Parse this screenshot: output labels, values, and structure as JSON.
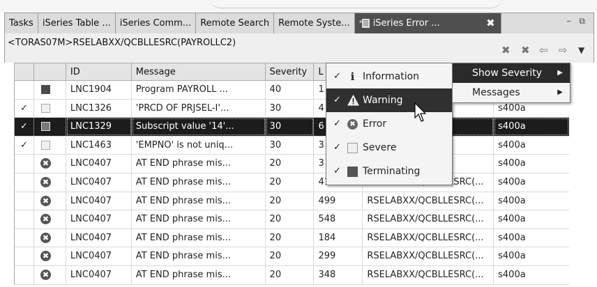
{
  "tabs": [
    {
      "label": "Tasks"
    },
    {
      "label": "iSeries Table ..."
    },
    {
      "label": "iSeries Comm..."
    },
    {
      "label": "Remote Search"
    },
    {
      "label": "Remote Syste..."
    },
    {
      "label": "iSeries Error ..."
    }
  ],
  "path": "<TORAS07M>RSELABXX/QCBLLESRC(PAYROLLC2)",
  "columns": {
    "id": "ID",
    "message": "Message",
    "severity": "Severity",
    "line": "L"
  },
  "rows": [
    {
      "check": "",
      "icon": "terminating",
      "id": "LNC1904",
      "message": "Program PAYROLL ...",
      "severity": "40",
      "line": "1",
      "file": "",
      "system": ""
    },
    {
      "check": "✓",
      "icon": "severe",
      "id": "LNC1326",
      "message": "'PRCD OF PRJSEL-I'...",
      "severity": "30",
      "line": "4",
      "file": "TSRC(...",
      "system": "s400a"
    },
    {
      "check": "✓",
      "icon": "terminating",
      "id": "LNC1329",
      "message": "Subscript value '14'...",
      "severity": "30",
      "line": "6",
      "file": "ESRC(...",
      "system": "s400a"
    },
    {
      "check": "✓",
      "icon": "severe",
      "id": "LNC1463",
      "message": "'EMPNO' is not uniq...",
      "severity": "30",
      "line": "3",
      "file": "TSRC(...",
      "system": "s400a"
    },
    {
      "check": "",
      "icon": "error",
      "id": "LNC0407",
      "message": "AT END phrase mis...",
      "severity": "20",
      "line": "3",
      "file": "TSRC(...",
      "system": "s400a"
    },
    {
      "check": "",
      "icon": "error",
      "id": "LNC0407",
      "message": "AT END phrase mis...",
      "severity": "20",
      "line": "410",
      "file": "RSELABXX/QCBLLESRC(...",
      "system": "s400a"
    },
    {
      "check": "",
      "icon": "error",
      "id": "LNC0407",
      "message": "AT END phrase mis...",
      "severity": "20",
      "line": "499",
      "file": "RSELABXX/QCBLLESRC(...",
      "system": "s400a"
    },
    {
      "check": "",
      "icon": "error",
      "id": "LNC0407",
      "message": "AT END phrase mis...",
      "severity": "20",
      "line": "548",
      "file": "RSELABXX/QCBLLESRC(...",
      "system": "s400a"
    },
    {
      "check": "",
      "icon": "error",
      "id": "LNC0407",
      "message": "AT END phrase mis...",
      "severity": "20",
      "line": "184",
      "file": "RSELABXX/QCBLLESRC(...",
      "system": "s400a"
    },
    {
      "check": "",
      "icon": "error",
      "id": "LNC0407",
      "message": "AT END phrase mis...",
      "severity": "20",
      "line": "299",
      "file": "RSELABXX/QCBLLESRC(...",
      "system": "s400a"
    },
    {
      "check": "",
      "icon": "error",
      "id": "LNC0407",
      "message": "AT END phrase mis...",
      "severity": "20",
      "line": "348",
      "file": "RSELABXX/QCBLLESRC(...",
      "system": "s400a"
    }
  ],
  "severity_menu": [
    {
      "check": "✓",
      "icon": "information-icon",
      "glyph": "i",
      "label": "Information"
    },
    {
      "check": "✓",
      "icon": "warning-icon",
      "glyph": "",
      "label": "Warning"
    },
    {
      "check": "✓",
      "icon": "error-icon",
      "glyph": "✖",
      "label": "Error"
    },
    {
      "check": "✓",
      "icon": "severe-icon",
      "glyph": "",
      "label": "Severe"
    },
    {
      "check": "✓",
      "icon": "terminating-icon",
      "glyph": "",
      "label": "Terminating"
    }
  ],
  "submenu": [
    {
      "label": "Show Severity",
      "arrow": "▶"
    },
    {
      "label": "Messages",
      "arrow": "▶"
    }
  ],
  "toolbar_glyphs": {
    "close": "✖",
    "close_all": "✖",
    "back": "⇦",
    "forward": "⇨",
    "menu": "▼",
    "tab_close": "✖",
    "win": "– ⧉",
    "error_glyph": "✖"
  }
}
